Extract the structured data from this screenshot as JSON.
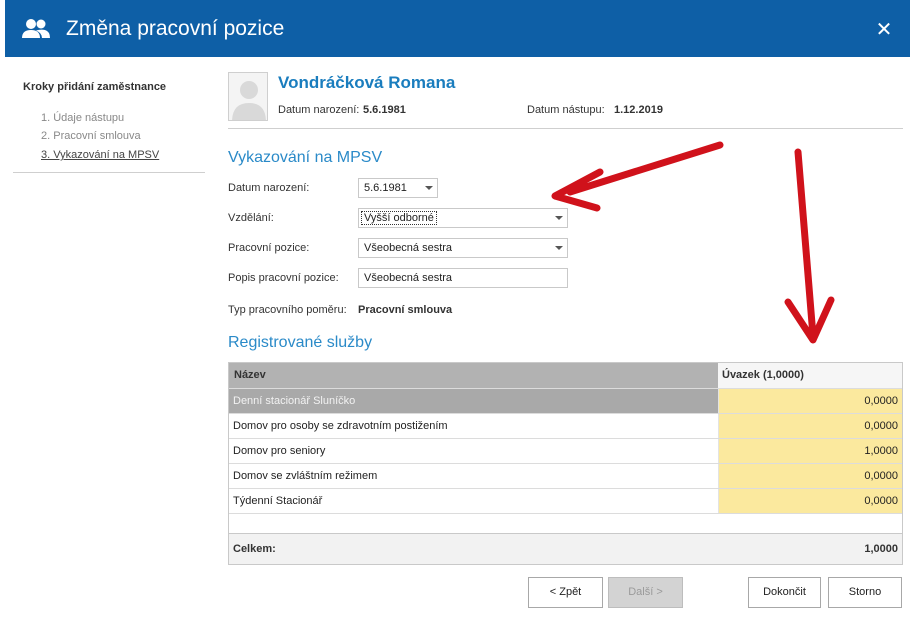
{
  "window": {
    "title": "Změna pracovní pozice",
    "close_label": "✕",
    "icon": "users-icon",
    "accent_color": "#0e5fa6"
  },
  "steps": {
    "title": "Kroky přidání zaměstnance",
    "items": [
      {
        "label": "1. Údaje nástupu",
        "active": false
      },
      {
        "label": "2. Pracovní smlouva",
        "active": false
      },
      {
        "label": "3. Vykazování na MPSV",
        "active": true
      }
    ]
  },
  "employee": {
    "name": "Vondráčková Romana",
    "birth_label": "Datum narození:",
    "birth_value": "5.6.1981",
    "start_label": "Datum nástupu:",
    "start_value": "1.12.2019",
    "avatar_icon": "person-silhouette-icon"
  },
  "mpsv": {
    "title": "Vykazování na MPSV",
    "fields": {
      "birth": {
        "label": "Datum narození:",
        "value": "5.6.1981"
      },
      "education": {
        "label": "Vzdělání:",
        "value": "Vyšší odborné"
      },
      "position": {
        "label": "Pracovní pozice:",
        "value": "Všeobecná sestra"
      },
      "position_desc": {
        "label": "Popis pracovní pozice:",
        "value": "Všeobecná sestra"
      },
      "employment_type": {
        "label": "Typ pracovního poměru:",
        "value": "Pracovní smlouva"
      }
    }
  },
  "services": {
    "title": "Registrované služby",
    "columns": [
      "Název",
      "Úvazek (1,0000)"
    ],
    "rows": [
      {
        "name": "Denní stacionář Sluníčko",
        "value": "0,0000"
      },
      {
        "name": "Domov pro osoby se zdravotním postižením",
        "value": "0,0000"
      },
      {
        "name": "Domov pro seniory",
        "value": "1,0000"
      },
      {
        "name": "Domov se zvláštním režimem",
        "value": "0,0000"
      },
      {
        "name": "Týdenní Stacionář",
        "value": "0,0000"
      }
    ],
    "total_label": "Celkem:",
    "total_value": "1,0000",
    "value_cell_color": "#fbe99e"
  },
  "buttons": {
    "back": "< Zpět",
    "next": "Další >",
    "finish": "Dokončit",
    "cancel": "Storno"
  },
  "annotation_color": "#d0121b"
}
